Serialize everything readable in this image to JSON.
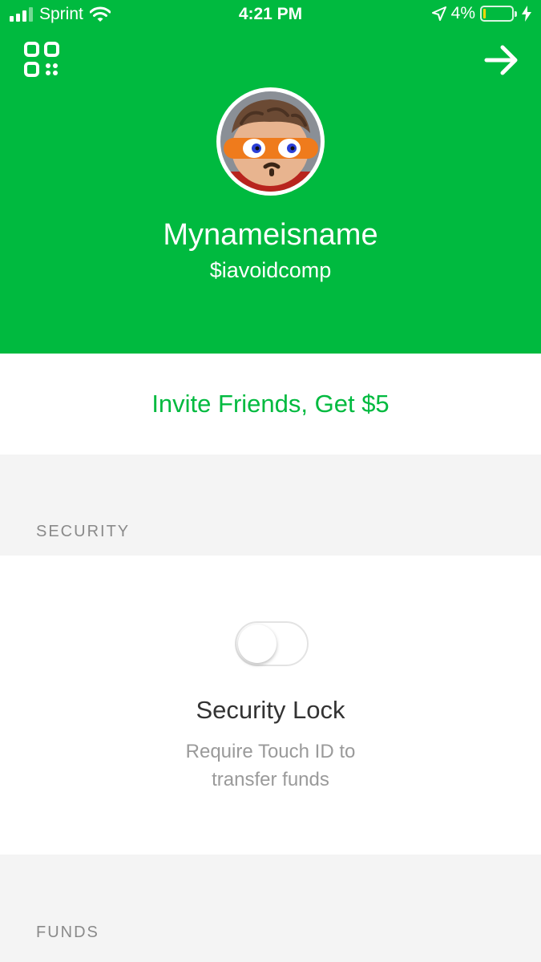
{
  "colors": {
    "brand_green": "#00ba3f",
    "section_bg": "#f4f4f4",
    "label_gray": "#8a8a8a",
    "battery_low": "#ffd60a"
  },
  "status_bar": {
    "carrier": "Sprint",
    "time": "4:21 PM",
    "battery_percent": "4%",
    "battery_level": 0.04,
    "signal_bars_active": 3,
    "signal_bars_total": 4,
    "icons": [
      "signal-icon",
      "wifi-icon",
      "location-arrow-icon",
      "battery-icon",
      "charging-bolt-icon"
    ]
  },
  "header": {
    "left_icon": "qr-code-icon",
    "right_icon": "arrow-right-icon"
  },
  "profile": {
    "avatar_icon": "avatar-image",
    "display_name": "Mynameisname",
    "cashtag": "$iavoidcomp"
  },
  "invite": {
    "label": "Invite Friends, Get $5"
  },
  "security": {
    "section_label": "SECURITY",
    "lock": {
      "title": "Security Lock",
      "description_line1": "Require Touch ID to",
      "description_line2": "transfer funds",
      "enabled": false
    }
  },
  "funds": {
    "section_label": "FUNDS"
  }
}
